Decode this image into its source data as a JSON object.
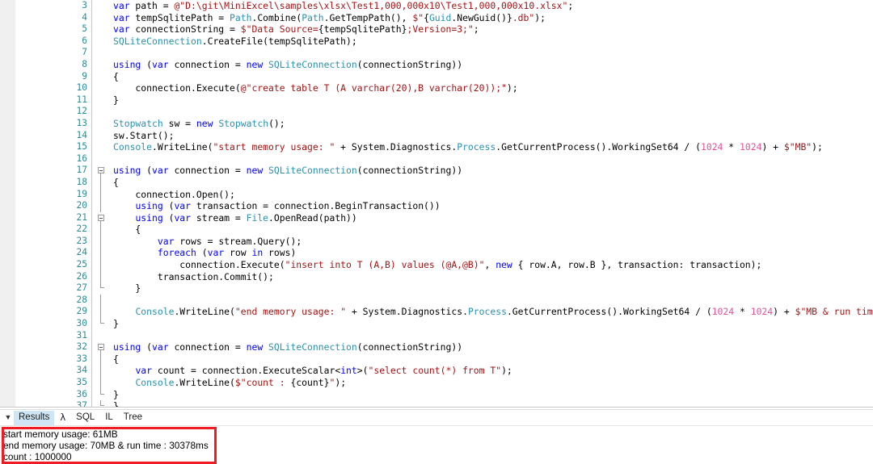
{
  "editor": {
    "language": "csharp",
    "colors": {
      "keyword": "#0000ff",
      "string": "#a31515",
      "type": "#2b91af",
      "number": "#e0529c",
      "linenumber": "#2e8b96",
      "background": "#ffffff"
    },
    "first_visible_line": 3,
    "last_visible_line": 37,
    "lines": [
      {
        "n": 3,
        "fold": "none",
        "html": "<span class=\"kw\">var</span> path = <span class=\"str\">@\"D:\\git\\MiniExcel\\samples\\xlsx\\Test1,000,000x10\\Test1,000,000x10.xlsx\"</span>;"
      },
      {
        "n": 4,
        "fold": "none",
        "html": "<span class=\"kw\">var</span> tempSqlitePath = <span class=\"type\">Path</span>.Combine(<span class=\"type\">Path</span>.GetTempPath(), <span class=\"str\">$\"</span>{<span class=\"type\">Guid</span>.NewGuid()}<span class=\"str\">.db\"</span>);"
      },
      {
        "n": 5,
        "fold": "none",
        "html": "<span class=\"kw\">var</span> connectionString = <span class=\"str\">$\"Data Source=</span>{tempSqlitePath}<span class=\"str\">;Version=3;\"</span>;"
      },
      {
        "n": 6,
        "fold": "none",
        "html": "<span class=\"type\">SQLiteConnection</span>.CreateFile(tempSqlitePath);"
      },
      {
        "n": 7,
        "fold": "none",
        "html": ""
      },
      {
        "n": 8,
        "fold": "none",
        "html": "<span class=\"kw\">using</span> (<span class=\"kw\">var</span> connection = <span class=\"kw\">new</span> <span class=\"type\">SQLiteConnection</span>(connectionString))"
      },
      {
        "n": 9,
        "fold": "none",
        "html": "{"
      },
      {
        "n": 10,
        "fold": "none",
        "html": "    connection.Execute(<span class=\"str\">@\"create table T (A varchar(20),B varchar(20));\"</span>);"
      },
      {
        "n": 11,
        "fold": "none",
        "html": "}"
      },
      {
        "n": 12,
        "fold": "none",
        "html": ""
      },
      {
        "n": 13,
        "fold": "none",
        "html": "<span class=\"type\">Stopwatch</span> sw = <span class=\"kw\">new</span> <span class=\"type\">Stopwatch</span>();"
      },
      {
        "n": 14,
        "fold": "none",
        "html": "sw.Start();"
      },
      {
        "n": 15,
        "fold": "none",
        "html": "<span class=\"type\">Console</span>.WriteLine(<span class=\"str\">\"start memory usage: \"</span> + <span class=\"plain\">System</span>.<span class=\"plain\">Diagnostics</span>.<span class=\"type\">Process</span>.GetCurrentProcess().WorkingSet64 / (<span class=\"num\">1024</span> * <span class=\"num\">1024</span>) + <span class=\"str\">$\"MB\"</span>);"
      },
      {
        "n": 16,
        "fold": "none",
        "html": ""
      },
      {
        "n": 17,
        "fold": "start",
        "html": "<span class=\"kw\">using</span> (<span class=\"kw\">var</span> connection = <span class=\"kw\">new</span> <span class=\"type\">SQLiteConnection</span>(connectionString))"
      },
      {
        "n": 18,
        "fold": "mid",
        "html": "{"
      },
      {
        "n": 19,
        "fold": "mid",
        "html": "    connection.Open();"
      },
      {
        "n": 20,
        "fold": "mid",
        "html": "    <span class=\"kw\">using</span> (<span class=\"kw\">var</span> transaction = connection.BeginTransaction())"
      },
      {
        "n": 21,
        "fold": "start",
        "html": "    <span class=\"kw\">using</span> (<span class=\"kw\">var</span> stream = <span class=\"type\">File</span>.OpenRead(path))"
      },
      {
        "n": 22,
        "fold": "mid",
        "html": "    {"
      },
      {
        "n": 23,
        "fold": "mid",
        "html": "        <span class=\"kw\">var</span> rows = stream.Query();"
      },
      {
        "n": 24,
        "fold": "mid",
        "html": "        <span class=\"kw\">foreach</span> (<span class=\"kw\">var</span> row <span class=\"kw\">in</span> rows)"
      },
      {
        "n": 25,
        "fold": "mid",
        "html": "            connection.Execute(<span class=\"str\">\"insert into T (A,B) values (@A,@B)\"</span>, <span class=\"kw\">new</span> { row.A, row.B }, transaction: transaction);"
      },
      {
        "n": 26,
        "fold": "mid",
        "html": "        transaction.Commit();"
      },
      {
        "n": 27,
        "fold": "end",
        "html": "    }"
      },
      {
        "n": 28,
        "fold": "mid",
        "html": ""
      },
      {
        "n": 29,
        "fold": "mid",
        "html": "    <span class=\"type\">Console</span>.WriteLine(<span class=\"str\">\"end memory usage: \"</span> + <span class=\"plain\">System</span>.<span class=\"plain\">Diagnostics</span>.<span class=\"type\">Process</span>.GetCurrentProcess().WorkingSet64 / (<span class=\"num\">1024</span> * <span class=\"num\">1024</span>) + <span class=\"str\">$\"MB &amp; run time : </span>{sw.ElapsedMilliseconds}<span class=\"str\">ms\"</span>);"
      },
      {
        "n": 30,
        "fold": "end",
        "html": "}"
      },
      {
        "n": 31,
        "fold": "none",
        "html": ""
      },
      {
        "n": 32,
        "fold": "start",
        "html": "<span class=\"kw\">using</span> (<span class=\"kw\">var</span> connection = <span class=\"kw\">new</span> <span class=\"type\">SQLiteConnection</span>(connectionString))"
      },
      {
        "n": 33,
        "fold": "mid",
        "html": "{"
      },
      {
        "n": 34,
        "fold": "mid",
        "html": "    <span class=\"kw\">var</span> count = connection.ExecuteScalar&lt;<span class=\"kw\">int</span>&gt;(<span class=\"str\">\"select count(*) from T\"</span>);"
      },
      {
        "n": 35,
        "fold": "mid",
        "html": "    <span class=\"type\">Console</span>.WriteLine(<span class=\"str\">$\"count : </span>{count}<span class=\"str\">\"</span>);"
      },
      {
        "n": 36,
        "fold": "end",
        "html": "}"
      },
      {
        "n": 37,
        "fold": "end",
        "html": "}"
      }
    ]
  },
  "results_panel": {
    "collapse_caret": "▼",
    "tabs": [
      {
        "id": "results",
        "label": "Results",
        "active": true
      },
      {
        "id": "lambda",
        "label": "λ",
        "active": false
      },
      {
        "id": "sql",
        "label": "SQL",
        "active": false
      },
      {
        "id": "il",
        "label": "IL",
        "active": false
      },
      {
        "id": "tree",
        "label": "Tree",
        "active": false
      }
    ],
    "output_lines": [
      "start memory usage: 61MB",
      "end memory usage: 70MB & run time : 30378ms",
      "count : 1000000"
    ],
    "annotation": {
      "color": "#ee1d23",
      "shape": "rectangle"
    }
  }
}
